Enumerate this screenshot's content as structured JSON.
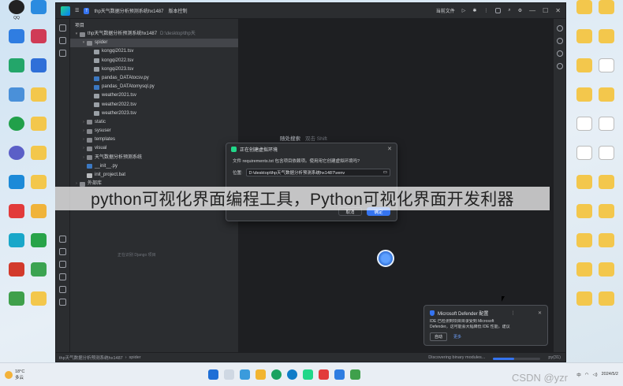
{
  "desktop": {
    "left_icons": [
      "QQ",
      "",
      "",
      "",
      "",
      "",
      "",
      "",
      "",
      "",
      "",
      ""
    ],
    "left_icons2": [
      "",
      "",
      "",
      "",
      "",
      "",
      "",
      "",
      "",
      "",
      "",
      ""
    ],
    "right_icons": [
      "",
      "",
      "",
      "",
      "",
      "",
      "",
      "",
      "",
      "",
      "",
      ""
    ]
  },
  "ide": {
    "titlebar": {
      "project": "thp天气数据分析预测系统hx1487",
      "vcs": "版本控制",
      "run_config": "当前文件"
    },
    "project_panel": {
      "title": "项目",
      "tree": [
        {
          "name": "thp天气数据分析预测系统hx1487",
          "path": "D:\\desktop\\thp天",
          "type": "folder",
          "indent": 0,
          "arrow": "▾"
        },
        {
          "name": "spider",
          "type": "folder",
          "indent": 1,
          "arrow": "▾",
          "selected": true
        },
        {
          "name": "kongqi2021.tsv",
          "type": "tsv",
          "indent": 2,
          "arrow": ""
        },
        {
          "name": "kongqi2022.tsv",
          "type": "tsv",
          "indent": 2,
          "arrow": ""
        },
        {
          "name": "kongqi2023.tsv",
          "type": "tsv",
          "indent": 2,
          "arrow": ""
        },
        {
          "name": "pandas_DATAtocsv.py",
          "type": "py",
          "indent": 2,
          "arrow": ""
        },
        {
          "name": "pandas_DATAtomysql.py",
          "type": "py",
          "indent": 2,
          "arrow": ""
        },
        {
          "name": "weather2021.tsv",
          "type": "tsv",
          "indent": 2,
          "arrow": ""
        },
        {
          "name": "weather2022.tsv",
          "type": "tsv",
          "indent": 2,
          "arrow": ""
        },
        {
          "name": "weather2023.tsv",
          "type": "tsv",
          "indent": 2,
          "arrow": ""
        },
        {
          "name": "static",
          "type": "folder",
          "indent": 1,
          "arrow": "›"
        },
        {
          "name": "sysuser",
          "type": "folder",
          "indent": 1,
          "arrow": "›"
        },
        {
          "name": "templates",
          "type": "folder",
          "indent": 1,
          "arrow": "›"
        },
        {
          "name": "visual",
          "type": "folder",
          "indent": 1,
          "arrow": "›"
        },
        {
          "name": "天气数据分析预测系统",
          "type": "folder",
          "indent": 1,
          "arrow": "›"
        },
        {
          "name": "__init__.py",
          "type": "py",
          "indent": 1,
          "arrow": ""
        },
        {
          "name": "init_project.bat",
          "type": "txt",
          "indent": 1,
          "arrow": ""
        },
        {
          "name": "外部库",
          "type": "folder",
          "indent": 0,
          "arrow": "›"
        }
      ],
      "footer": "正在识别 Django 项目"
    },
    "editor": {
      "hint": "随处搜索",
      "hint_key": "双击 Shift"
    },
    "statusbar": {
      "crumb1": "thp天气数据分析预测系统hx1487",
      "crumb2": "spider",
      "task": "Discovering binary modules...",
      "python": "py(31)",
      "progress": 0.45
    }
  },
  "dialog": {
    "title": "正在创建虚拟环境",
    "message": "文件 requirements.txt 包含项目依赖项。使用用它创建虚拟环境吗?",
    "location_label": "位置:",
    "location_value": "D:\\desktop\\thp天气数据分析预测系统hx1487\\venv",
    "cancel": "取消",
    "ok": "确定"
  },
  "toast": {
    "title": "Microsoft Defender 配置",
    "body1": "IDE 已检测到项目目录受到 Microsoft",
    "body2": "Defender。这可能会大幅降低 IDE 性能。建议",
    "action": "自动",
    "link": "更多"
  },
  "caption": "python可视化界面编程工具，Python可视化界面开发利器",
  "taskbar": {
    "weather_temp": "18°C",
    "weather_desc": "多云",
    "time": "2024/5/2",
    "watermark": "CSDN @yzr"
  },
  "colors": {
    "accent": "#3574f0",
    "ide_bg": "#2b2d30",
    "editor_bg": "#1e1f22"
  }
}
